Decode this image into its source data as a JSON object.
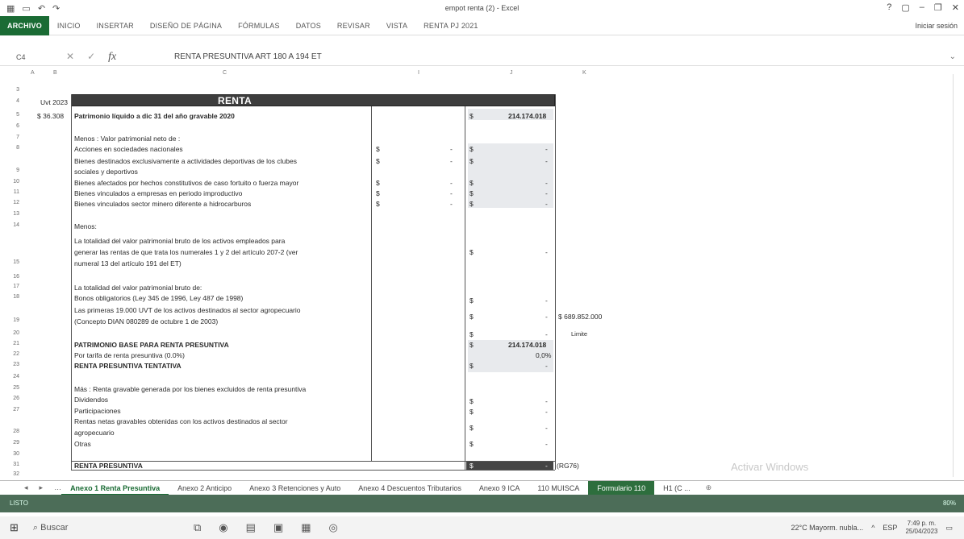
{
  "window": {
    "title": "empot renta (2) - Excel",
    "help": "?",
    "signin": "Iniciar sesión"
  },
  "ribbon": {
    "tabs": [
      "ARCHIVO",
      "INICIO",
      "INSERTAR",
      "DISEÑO DE PÁGINA",
      "FÓRMULAS",
      "DATOS",
      "REVISAR",
      "VISTA",
      "RENTA PJ 2021"
    ]
  },
  "formula_bar": {
    "name_box": "C4",
    "fx": "fx",
    "formula": "RENTA PRESUNTIVA  ART 180 A 194 ET"
  },
  "columns": [
    "A",
    "B",
    "C",
    "I",
    "J",
    "K"
  ],
  "rows": [
    "3",
    "4",
    "5",
    "6",
    "7",
    "8",
    "9",
    "10",
    "11",
    "12",
    "13",
    "14",
    "15",
    "16",
    "17",
    "18",
    "19",
    "20",
    "21",
    "22",
    "23",
    "24",
    "25",
    "26",
    "27",
    "28",
    "29",
    "30",
    "31",
    "32"
  ],
  "sheet": {
    "header_title": "RENTA PRESUNTIVA  ART 180 A 194 ET",
    "uvt_label": "Uvt 2023",
    "uvt_value": "$ 36.308",
    "patrimonio_label": "Patrimonio líquido a dic 31 del año gravable 2020",
    "patrimonio_value": "214.174.018",
    "menos_label": "Menos : Valor patrimonial neto de :",
    "items1": [
      "Acciones en sociedades nacionales",
      "Bienes destinados exclusivamente a actividades deportivas de los clubes",
      "sociales y deportivos",
      "Bienes afectados por hechos constitutivos de caso fortuito o fuerza mayor",
      "Bienes vinculados a empresas en periodo improductivo",
      "Bienes vinculados sector minero diferente a hidrocarburos"
    ],
    "menos2": "Menos:",
    "totalidad1_l1": "La totalidad del valor patrimonial bruto de los activos empleados para",
    "totalidad1_l2": "generar las rentas de que trata los numerales 1 y 2 del artículo 207-2  (ver",
    "totalidad1_l3": "numeral 13 del artículo 191 del ET)",
    "totalidad2": "La totalidad del valor patrimonial bruto de:",
    "bonos": "Bonos obligatorios (Ley 345 de 1996, Ley 487 de 1998)",
    "primeras_l1": "Las primeras 19.000 UVT de los activos destinados al sector agropecuario",
    "primeras_l2": "(Concepto DIAN 080289 de octubre 1 de 2003)",
    "limit_value": "$ 689.852.000",
    "limit_label": "Limite",
    "base_label": "PATRIMONIO BASE PARA RENTA PRESUNTIVA",
    "base_value": "214.174.018",
    "tarifa_label": "Por tarifa de renta presuntiva (0.0%)",
    "tarifa_value": "0,0%",
    "tentativa_label": "RENTA PRESUNTIVA TENTATIVA",
    "mas_label": "Más : Renta gravable generada por los bienes excluidos de renta presuntiva",
    "dividendos": "Dividendos",
    "participaciones": "Participaciones",
    "rentas_l1": "Rentas netas gravables obtenidas con los activos destinados al sector",
    "rentas_l2": "agropecuario",
    "otras": "Otras",
    "final_label": "RENTA PRESUNTIVA",
    "final_ref": "(RG76)",
    "currency": "$",
    "dash": "-"
  },
  "sheet_tabs": [
    "Anexo 1 Renta Presuntiva",
    "Anexo 2 Anticipo",
    "Anexo 3 Retenciones y Auto",
    "Anexo 4 Descuentos Tributarios",
    "Anexo 9 ICA",
    "110 MUISCA",
    "Formulario 110",
    "H1 (C ..."
  ],
  "status": {
    "ready": "LISTO",
    "zoom": "80%"
  },
  "activate": "Activar Windows",
  "taskbar": {
    "search": "Buscar",
    "weather": "22°C  Mayorm. nubla...",
    "lang": "ESP",
    "time": "7:49 p. m.",
    "date": "25/04/2023"
  }
}
